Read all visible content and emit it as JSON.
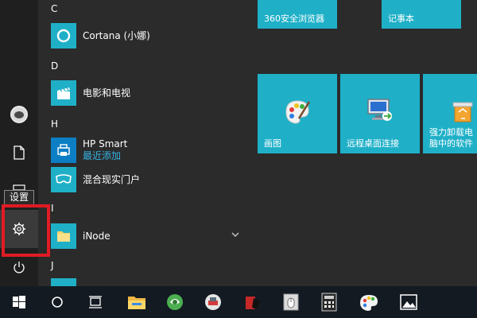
{
  "rail": {
    "settings_tooltip": "设置"
  },
  "app_list": {
    "sections": [
      {
        "letter": "C"
      },
      {
        "letter": "D"
      },
      {
        "letter": "H"
      },
      {
        "letter": "I"
      },
      {
        "letter": "J"
      }
    ],
    "apps": [
      {
        "name": "Cortana (小娜)",
        "icon": "cortana-icon"
      },
      {
        "name": "电影和电视",
        "icon": "film-icon"
      },
      {
        "name": "HP Smart",
        "sub": "最近添加",
        "icon": "hp-smart-icon"
      },
      {
        "name": "混合现实门户",
        "icon": "mixed-reality-icon"
      },
      {
        "name": "iNode",
        "icon": "folder-icon"
      }
    ]
  },
  "tiles": [
    {
      "label": "360安全浏览器"
    },
    {
      "label": "记事本"
    },
    {
      "label": "画图",
      "icon": "paint-palette-icon"
    },
    {
      "label": "远程桌面连接",
      "icon": "remote-desktop-icon"
    },
    {
      "label": "强力卸载电脑中的软件",
      "icon": "recycle-bin-icon"
    }
  ],
  "taskbar": {
    "items": [
      "windows-start-icon",
      "search-circle-icon",
      "task-view-icon",
      "file-explorer-icon",
      "browser-icon",
      "app-icon",
      "app-icon",
      "app-icon",
      "calculator-icon",
      "paint-icon",
      "photos-icon"
    ]
  },
  "colors": {
    "tile": "#1fb0c8",
    "highlight": "#e01b24",
    "taskbar": "#131a22"
  }
}
